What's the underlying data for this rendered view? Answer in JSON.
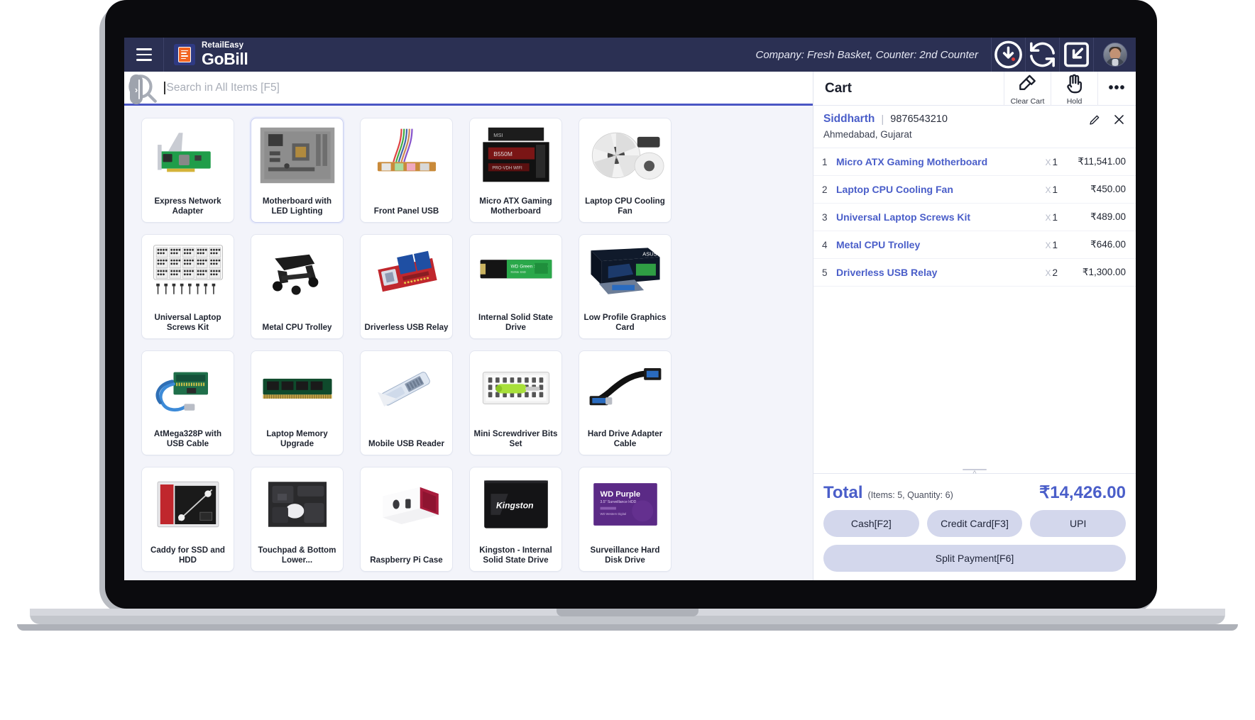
{
  "header": {
    "menu_icon": "hamburger-icon",
    "brand_top": "RetailEasy",
    "brand_bottom": "GoBill",
    "company_counter": "Company: Fresh Basket,  Counter: 2nd Counter",
    "icons": [
      {
        "name": "pending-sync-icon",
        "glyph": "download-clock",
        "badge": true
      },
      {
        "name": "refresh-icon",
        "glyph": "sync"
      },
      {
        "name": "collapse-screen-icon",
        "glyph": "minimize"
      }
    ],
    "avatar_name": "user-avatar"
  },
  "search": {
    "placeholder": "Search in All Items [F5]",
    "value": "",
    "icon": "search-icon",
    "sidebar_toggle": "›"
  },
  "products": [
    {
      "name": "Express Network Adapter",
      "art": "network-card"
    },
    {
      "name": "Motherboard with LED Lighting",
      "art": "motherboard-led",
      "active": true
    },
    {
      "name": "Front Panel USB",
      "art": "front-panel"
    },
    {
      "name": "Micro ATX Gaming Motherboard",
      "art": "matx-board"
    },
    {
      "name": "Laptop CPU Cooling Fan",
      "art": "cooling-fan"
    },
    {
      "name": "Universal Laptop Screws Kit",
      "art": "screws-kit"
    },
    {
      "name": "Metal CPU Trolley",
      "art": "cpu-trolley"
    },
    {
      "name": "Driverless USB Relay",
      "art": "usb-relay"
    },
    {
      "name": "Internal Solid State Drive",
      "art": "m2-ssd"
    },
    {
      "name": "Low Profile Graphics Card",
      "art": "gpu-box"
    },
    {
      "name": "AtMega328P with USB Cable",
      "art": "arduino"
    },
    {
      "name": "Laptop Memory Upgrade",
      "art": "ram-stick"
    },
    {
      "name": "Mobile USB Reader",
      "art": "usb-reader"
    },
    {
      "name": "Mini Screwdriver Bits Set",
      "art": "screwdriver-set"
    },
    {
      "name": "Hard Drive Adapter Cable",
      "art": "sata-cable"
    },
    {
      "name": "Caddy for SSD and HDD",
      "art": "hdd-caddy"
    },
    {
      "name": "Touchpad & Bottom Lower...",
      "art": "touchpad"
    },
    {
      "name": "Raspberry Pi Case",
      "art": "pi-case"
    },
    {
      "name": "Kingston - Internal Solid State Drive",
      "art": "kingston-ssd"
    },
    {
      "name": "Surveillance Hard Disk Drive",
      "art": "wd-purple"
    },
    {
      "name": "",
      "art": "tripod-head"
    },
    {
      "name": "",
      "art": "straps"
    },
    {
      "name": "",
      "art": "black-box"
    },
    {
      "name": "",
      "art": "camera-rig"
    },
    {
      "name": "",
      "art": "envie-pack"
    }
  ],
  "cart": {
    "title": "Cart",
    "actions": [
      {
        "name": "clear-cart",
        "label": "Clear Cart",
        "icon": "broom-icon"
      },
      {
        "name": "hold",
        "label": "Hold",
        "icon": "hand-icon"
      }
    ],
    "more_glyph": "•••",
    "customer": {
      "name": "Siddharth",
      "separator": "|",
      "phone": "9876543210",
      "address": "Ahmedabad, Gujarat",
      "edit_icon": "pencil-icon",
      "close_icon": "close-icon"
    },
    "items": [
      {
        "index": "1",
        "name": "Micro ATX Gaming Motherboard",
        "qty": "1",
        "qty_prefix": "X",
        "amount": "₹11,541.00"
      },
      {
        "index": "2",
        "name": "Laptop CPU Cooling Fan",
        "qty": "1",
        "qty_prefix": "X",
        "amount": "₹450.00"
      },
      {
        "index": "3",
        "name": "Universal Laptop Screws Kit",
        "qty": "1",
        "qty_prefix": "X",
        "amount": "₹489.00"
      },
      {
        "index": "4",
        "name": "Metal CPU Trolley",
        "qty": "1",
        "qty_prefix": "X",
        "amount": "₹646.00"
      },
      {
        "index": "5",
        "name": "Driverless USB Relay",
        "qty": "2",
        "qty_prefix": "X",
        "amount": "₹1,300.00"
      }
    ],
    "total": {
      "word": "Total",
      "meta": "(Items: 5, Quantity: 6)",
      "amount": "₹14,426.00"
    },
    "payment_buttons": [
      {
        "name": "cash",
        "label": "Cash[F2]"
      },
      {
        "name": "credit-card",
        "label": "Credit Card[F3]"
      },
      {
        "name": "upi",
        "label": "UPI"
      }
    ],
    "split_button": {
      "name": "split-payment",
      "label": "Split Payment[F6]"
    }
  },
  "colors": {
    "header_bg": "#2b3053",
    "accent": "#4a5ec9",
    "app_bg": "#f3f4fa",
    "pay_btn": "#d3d7ec"
  }
}
